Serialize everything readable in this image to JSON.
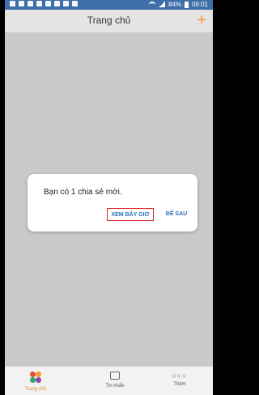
{
  "status_bar": {
    "battery_percent": "84%",
    "time": "09:01"
  },
  "header": {
    "title": "Trang chủ",
    "add_icon": "+"
  },
  "dialog": {
    "message": "Bạn có 1 chia sẻ mới.",
    "primary_button": "XEM BÂY GIỜ",
    "secondary_button": "ĐỂ SAU"
  },
  "tabs": [
    {
      "label": "Trang chủ",
      "icon": "app-logo-icon",
      "active": true
    },
    {
      "label": "Tin nhắn",
      "icon": "message-icon",
      "active": false
    },
    {
      "label": "Thêm",
      "icon": "more-icon",
      "active": false
    }
  ],
  "colors": {
    "accent": "#f39c2f",
    "status_bar": "#3f6fa8",
    "button_text": "#2c6fb3",
    "highlight_border": "#dd2222"
  }
}
